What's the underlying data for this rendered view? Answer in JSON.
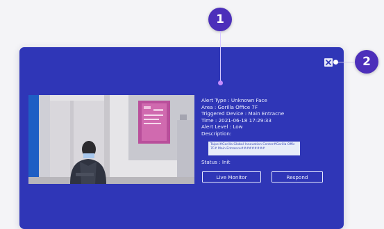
{
  "callouts": {
    "one": "1",
    "two": "2"
  },
  "alert": {
    "type": "Alert Type : Unknown Face",
    "area": "Area : Gorilla Office 7F",
    "device": "Triggered Device : Main Entracne",
    "time": "Time : 2021-06-18 17:29:33",
    "level": "Alert Level : Low",
    "description_label": "Description:",
    "description_text": "Taipei#Gorilla Global Innovation Center#Gorilla Offic 7F# Main Entrance#########",
    "status": "Status : Init"
  },
  "buttons": {
    "live_monitor": "Live Monitor",
    "respond": "Respond"
  },
  "icons": {
    "close": "close-icon"
  },
  "colors": {
    "modal": "#2f36b7",
    "badge": "#4c2fba",
    "text": "#eef0ff"
  }
}
